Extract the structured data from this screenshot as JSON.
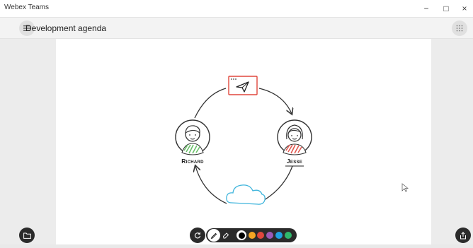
{
  "window": {
    "app_title": "Webex Teams",
    "minimize_glyph": "−",
    "maximize_glyph": "□",
    "close_glyph": "×"
  },
  "header": {
    "title": "Development agenda",
    "menu_icon": "hamburger-menu-icon",
    "apps_icon": "grid-dots-icon"
  },
  "whiteboard": {
    "person_left_label": "Richard",
    "person_right_label": "Jesse",
    "top_box_icon": "paper-plane-icon",
    "bottom_icon": "cloud-icon",
    "colors": {
      "arrow": "#333333",
      "top_box_border": "#e0473d",
      "cloud": "#3fb5dc",
      "left_shirt": "#6abf69",
      "right_shirt": "#e0574f"
    }
  },
  "toolbar": {
    "undo_icon": "undo-icon",
    "pen_icon": "pen-icon",
    "eraser_icon": "eraser-icon",
    "swatches": [
      "#ffffff",
      "#f5a623",
      "#e0473d",
      "#9b59b6",
      "#1fa1e0",
      "#2fb86b"
    ],
    "selected_swatch": "#000000"
  },
  "side_buttons": {
    "left_icon": "folder-icon",
    "right_icon": "share-icon"
  }
}
